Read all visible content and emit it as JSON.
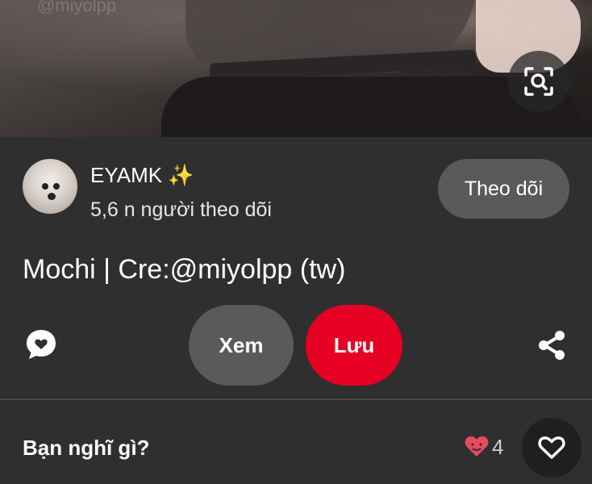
{
  "image": {
    "watermark": "@miyolpp"
  },
  "creator": {
    "name": "EYAMK ✨",
    "followers": "5,6 n người theo dõi",
    "follow_label": "Theo dõi"
  },
  "pin": {
    "title": "Mochi | Cre:@miyolpp (tw)"
  },
  "actions": {
    "view_label": "Xem",
    "save_label": "Lưu"
  },
  "comments": {
    "prompt": "Bạn nghĩ gì?",
    "reaction_count": "4"
  },
  "icons": {
    "lens": "visual-search-icon",
    "comment": "comment-bubble-icon",
    "share": "share-icon",
    "reaction": "heart-eyes-icon",
    "like": "heart-outline-icon"
  },
  "colors": {
    "background": "#2f2f2f",
    "save": "#e60023",
    "pill": "#5a5a5a"
  }
}
